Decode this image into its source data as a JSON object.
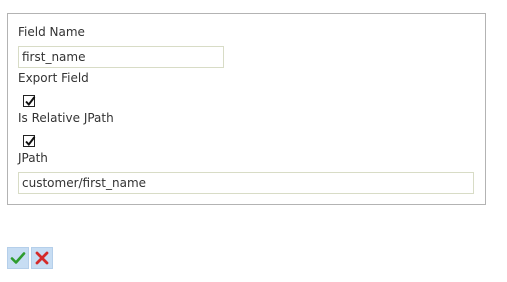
{
  "form": {
    "field_name_label": "Field Name",
    "field_name_value": "first_name",
    "export_field_label": "Export Field",
    "export_field_checked": true,
    "is_relative_label": "Is Relative JPath",
    "is_relative_checked": true,
    "jpath_label": "JPath",
    "jpath_value": "customer/first_name"
  },
  "actions": {
    "confirm_icon": "checkmark-icon",
    "cancel_icon": "close-icon",
    "confirm_color": "#2e9c2e",
    "cancel_color": "#d42a2a"
  }
}
